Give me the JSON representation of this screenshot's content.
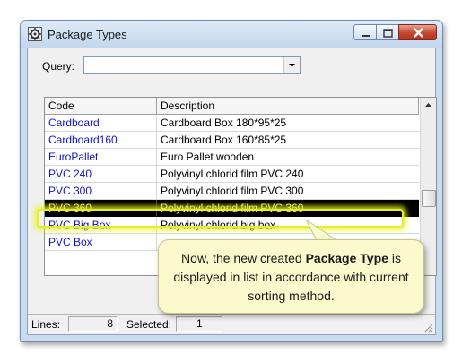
{
  "window": {
    "title": "Package Types"
  },
  "query": {
    "label": "Query:",
    "value": ""
  },
  "list": {
    "headers": {
      "code": "Code",
      "description": "Description"
    },
    "rows": [
      {
        "code": "Cardboard",
        "description": "Cardboard Box 180*95*25"
      },
      {
        "code": "Cardboard160",
        "description": "Cardboard Box 160*85*25"
      },
      {
        "code": "EuroPallet",
        "description": "Euro Pallet wooden"
      },
      {
        "code": "PVC 240",
        "description": "Polyvinyl chlorid film PVC 240"
      },
      {
        "code": "PVC 300",
        "description": "Polyvinyl chlorid film PVC 300"
      },
      {
        "code": "PVC 360",
        "description": "Polyvinyl chlorid film PVC 360",
        "selected": true
      },
      {
        "code": "PVC Big Box",
        "description": "Polyvinyl chlorid big box"
      },
      {
        "code": "PVC Box",
        "description": ""
      }
    ]
  },
  "status": {
    "lines_label": "Lines:",
    "lines_value": "8",
    "selected_label": "Selected:",
    "selected_value": "1"
  },
  "callout": {
    "text_before": "Now, the new created ",
    "text_bold": "Package Type",
    "text_after": " is displayed in list in accordance with current sorting method."
  },
  "colors": {
    "code_link": "#1212c8",
    "selected_row_bg": "#000000",
    "selected_row_text": "#f1f16a",
    "highlight_glow": "#e4ef2a",
    "callout_bg": "#fafacd",
    "close_button": "#c5452d"
  },
  "icons": {
    "app": "gear-icon",
    "minimize": "minimize-icon",
    "maximize": "maximize-icon",
    "close": "close-icon",
    "combo": "chevron-down-icon",
    "scroll_up": "scroll-up-arrow-icon",
    "grip": "resize-grip-icon"
  }
}
